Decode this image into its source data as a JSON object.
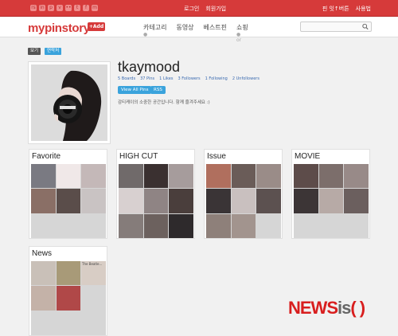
{
  "topbar": {
    "social_icons": [
      "rss-icon",
      "linkedin-icon",
      "pinterest-icon",
      "vimeo-icon",
      "flickr-icon",
      "tumblr-icon",
      "facebook-icon",
      "more-icon"
    ],
    "social_glyphs": [
      "rs",
      "in",
      "p",
      "v",
      "••",
      "t",
      "f",
      "m"
    ],
    "login": "로그인",
    "signup": "회원가입",
    "right1": "핀 잇↑버튼",
    "right2": "사용법"
  },
  "header": {
    "logo": "mypinstory",
    "add_label": "+Add",
    "nav": [
      "카테고리",
      "동영상",
      "베스트핀",
      "쇼핑"
    ],
    "nav_dot": "●",
    "nav_or": "or",
    "search_placeholder": ""
  },
  "tags": [
    "보기",
    "연락처"
  ],
  "profile": {
    "username": "tkaymood",
    "stats": [
      "5 Boards",
      "37 Pins",
      "1 Likes",
      "3 Followers",
      "1 Following",
      "2 Unfollowers"
    ],
    "view_pins": "View All Pins",
    "rss": "RSS",
    "bio": "감티케이의 소중한 공간입니다. 함께 즐겨주세요 :)"
  },
  "boards": [
    {
      "title": "Favorite",
      "tile_colors": [
        "#7a7a82",
        "#f0e8e8",
        "#c4b8b8",
        "#8a6f66",
        "#5a4d4a",
        "#c9c3c3",
        "#d6d6d6",
        "#d6d6d6",
        "#d6d6d6"
      ]
    },
    {
      "title": "HIGH CUT",
      "tile_colors": [
        "#706a6a",
        "#3a3030",
        "#a69c9c",
        "#d8d0d0",
        "#8f8484",
        "#4a3e3c",
        "#857c7a",
        "#6c615e",
        "#2e2a2c"
      ]
    },
    {
      "title": "Issue",
      "tile_colors": [
        "#b06f5e",
        "#6a5c58",
        "#9a8c88",
        "#3a3436",
        "#c9c0bf",
        "#5c5150",
        "#8e807a",
        "#a2948e",
        "#d6d6d6"
      ]
    },
    {
      "title": "MOVIE",
      "tile_colors": [
        "#5d4c4a",
        "#7c6e6b",
        "#988a88",
        "#3c3536",
        "#b7aaa6",
        "#6b5f5e",
        "#d6d6d6",
        "#d6d6d6",
        "#d6d6d6"
      ]
    },
    {
      "title": "News",
      "tile_colors": [
        "#c9c0b8",
        "#a89a78",
        "#d8cdc5",
        "#c4b2a8",
        "#b04848",
        "#d6d6d6",
        "#d6d6d6",
        "#d6d6d6",
        "#d6d6d6"
      ]
    }
  ],
  "news_brand_label": "The Beatle...",
  "watermark": {
    "a": "NEWS",
    "b": "is",
    "c": "( )"
  }
}
